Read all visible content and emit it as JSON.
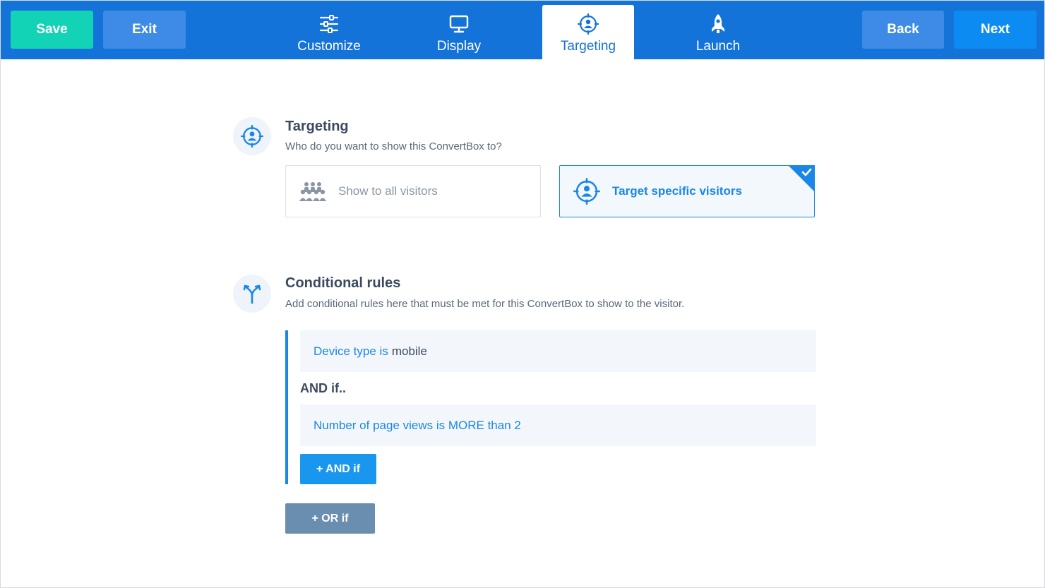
{
  "header": {
    "save_label": "Save",
    "exit_label": "Exit",
    "back_label": "Back",
    "next_label": "Next",
    "tabs": [
      {
        "label": "Customize",
        "icon": "sliders-icon"
      },
      {
        "label": "Display",
        "icon": "monitor-icon"
      },
      {
        "label": "Targeting",
        "icon": "target-user-icon",
        "active": true
      },
      {
        "label": "Launch",
        "icon": "rocket-icon"
      }
    ]
  },
  "targeting": {
    "title": "Targeting",
    "subtitle": "Who do you want to show this ConvertBox to?",
    "options": [
      {
        "label": "Show to all visitors",
        "icon": "group-icon",
        "selected": false
      },
      {
        "label": "Target specific visitors",
        "icon": "target-user-icon",
        "selected": true
      }
    ]
  },
  "conditional": {
    "title": "Conditional rules",
    "subtitle": "Add conditional rules here that must be met for this ConvertBox to show to the visitor.",
    "rule1_prefix": "Device type is",
    "rule1_value": "mobile",
    "and_text": "AND if..",
    "rule2": "Number of page views is MORE than 2",
    "and_button": "+ AND if",
    "or_button": "+ OR if"
  },
  "colors": {
    "topbar": "#1473d9",
    "save": "#12d3b6",
    "accent": "#1a86e8",
    "or_button": "#6a8eaf"
  }
}
